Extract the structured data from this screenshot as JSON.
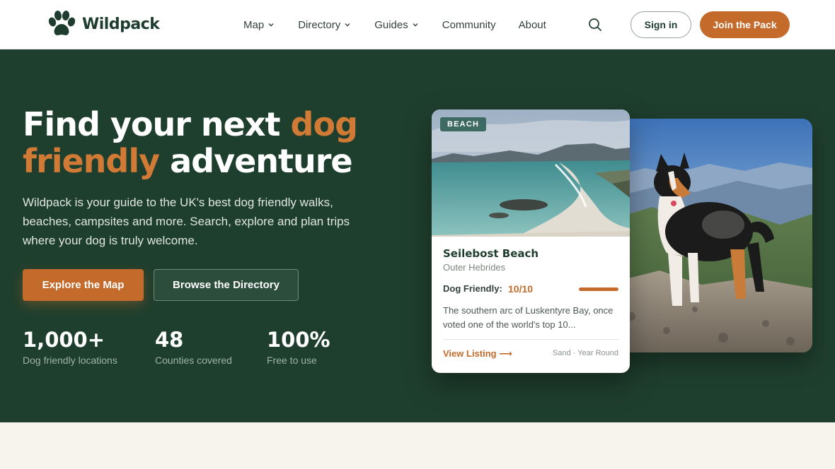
{
  "brand": {
    "name": "Wildpack",
    "color": "#1e3d2f",
    "accent": "#c46a2b"
  },
  "nav": {
    "items": [
      {
        "label": "Map",
        "dropdown": true
      },
      {
        "label": "Directory",
        "dropdown": true
      },
      {
        "label": "Guides",
        "dropdown": true
      },
      {
        "label": "Community",
        "dropdown": false
      },
      {
        "label": "About",
        "dropdown": false
      }
    ],
    "search_icon": "search-icon",
    "signin_label": "Sign in",
    "join_label": "Join the Pack"
  },
  "hero": {
    "headline_part1": "Find your next ",
    "headline_accent": "dog friendly",
    "headline_part2": " adventure",
    "lead": "Wildpack is your guide to the UK's best dog friendly walks, beaches, campsites and more. Search, explore and plan trips where your dog is truly welcome.",
    "primary_cta": "Explore the Map",
    "secondary_cta": "Browse the Directory",
    "stats": [
      {
        "value": "1,000+",
        "label": "Dog friendly locations"
      },
      {
        "value": "48",
        "label": "Counties covered"
      },
      {
        "value": "100%",
        "label": "Free to use"
      }
    ]
  },
  "listing_card": {
    "badge": "BEACH",
    "title": "Seilebost Beach",
    "region": "Outer Hebrides",
    "dog_friendly_label": "Dog Friendly:",
    "dog_friendly_score": "10/10",
    "dog_friendly_fraction": 1.0,
    "description": "The southern arc of Luskentyre Bay, once voted one of the world's top 10...",
    "link_label": "View Listing",
    "link_icon": "arrow-right-icon",
    "meta": "Sand · Year Round"
  },
  "side_image": {
    "subject": "dog-on-mountain-photo"
  }
}
